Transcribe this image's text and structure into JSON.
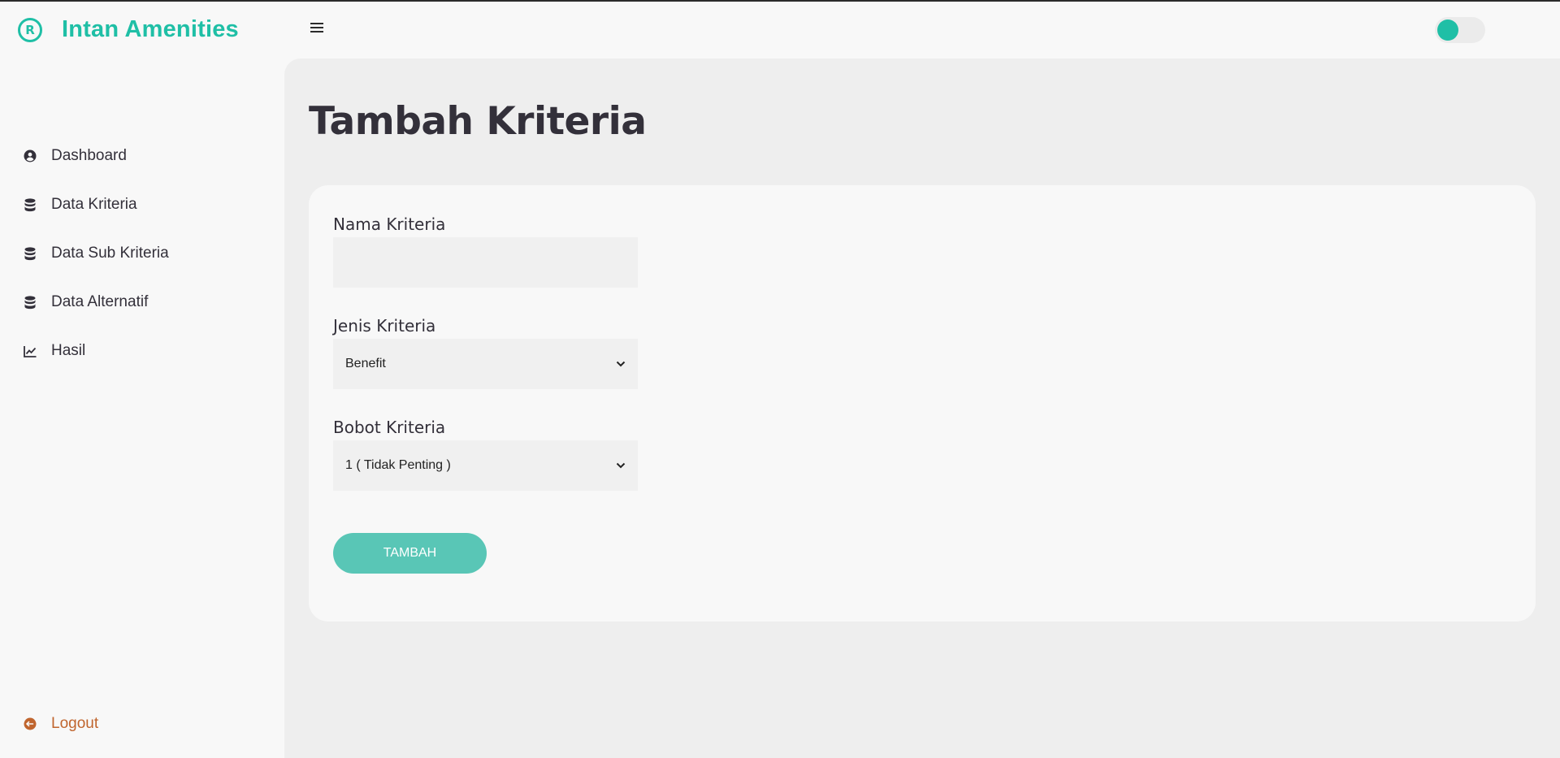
{
  "brand": {
    "name": "Intan Amenities",
    "icon": "registered-icon",
    "color": "#1fbfa6"
  },
  "sidebar": {
    "items": [
      {
        "label": "Dashboard",
        "icon": "user-circle-icon"
      },
      {
        "label": "Data Kriteria",
        "icon": "database-icon"
      },
      {
        "label": "Data Sub Kriteria",
        "icon": "database-icon"
      },
      {
        "label": "Data Alternatif",
        "icon": "database-icon"
      },
      {
        "label": "Hasil",
        "icon": "line-chart-icon"
      }
    ],
    "logout": {
      "label": "Logout",
      "icon": "logout-icon",
      "color": "#c0652e"
    }
  },
  "header": {
    "menu_icon": "hamburger-icon",
    "theme_toggle": {
      "state": "off",
      "color": "#1fbfa6"
    }
  },
  "page": {
    "title": "Tambah Kriteria"
  },
  "form": {
    "nama": {
      "label": "Nama Kriteria",
      "value": ""
    },
    "jenis": {
      "label": "Jenis Kriteria",
      "selected": "Benefit"
    },
    "bobot": {
      "label": "Bobot Kriteria",
      "selected": "1 ( Tidak Penting )"
    },
    "submit": {
      "label": "TAMBAH",
      "color": "#59c6b6"
    }
  }
}
